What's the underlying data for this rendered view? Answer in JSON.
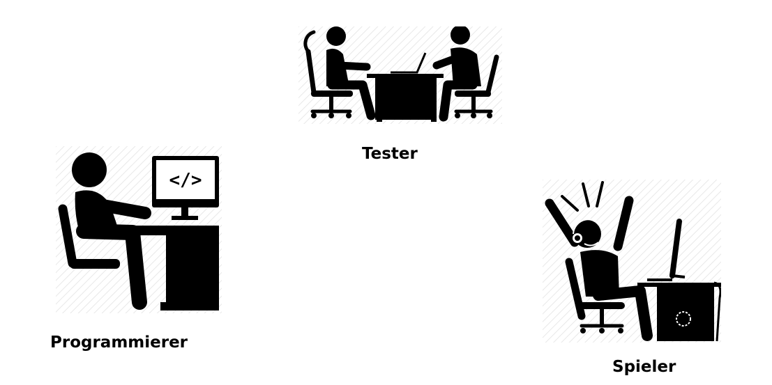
{
  "roles": {
    "tester": {
      "label": "Tester",
      "icon": "two-people-meeting-at-desk-icon"
    },
    "programmer": {
      "label": "Programmierer",
      "icon": "programmer-at-computer-icon"
    },
    "player": {
      "label": "Spieler",
      "icon": "excited-gamer-icon"
    }
  },
  "colors": {
    "icon": "#000000",
    "hatch": "#e6e6e6",
    "background": "#ffffff"
  }
}
